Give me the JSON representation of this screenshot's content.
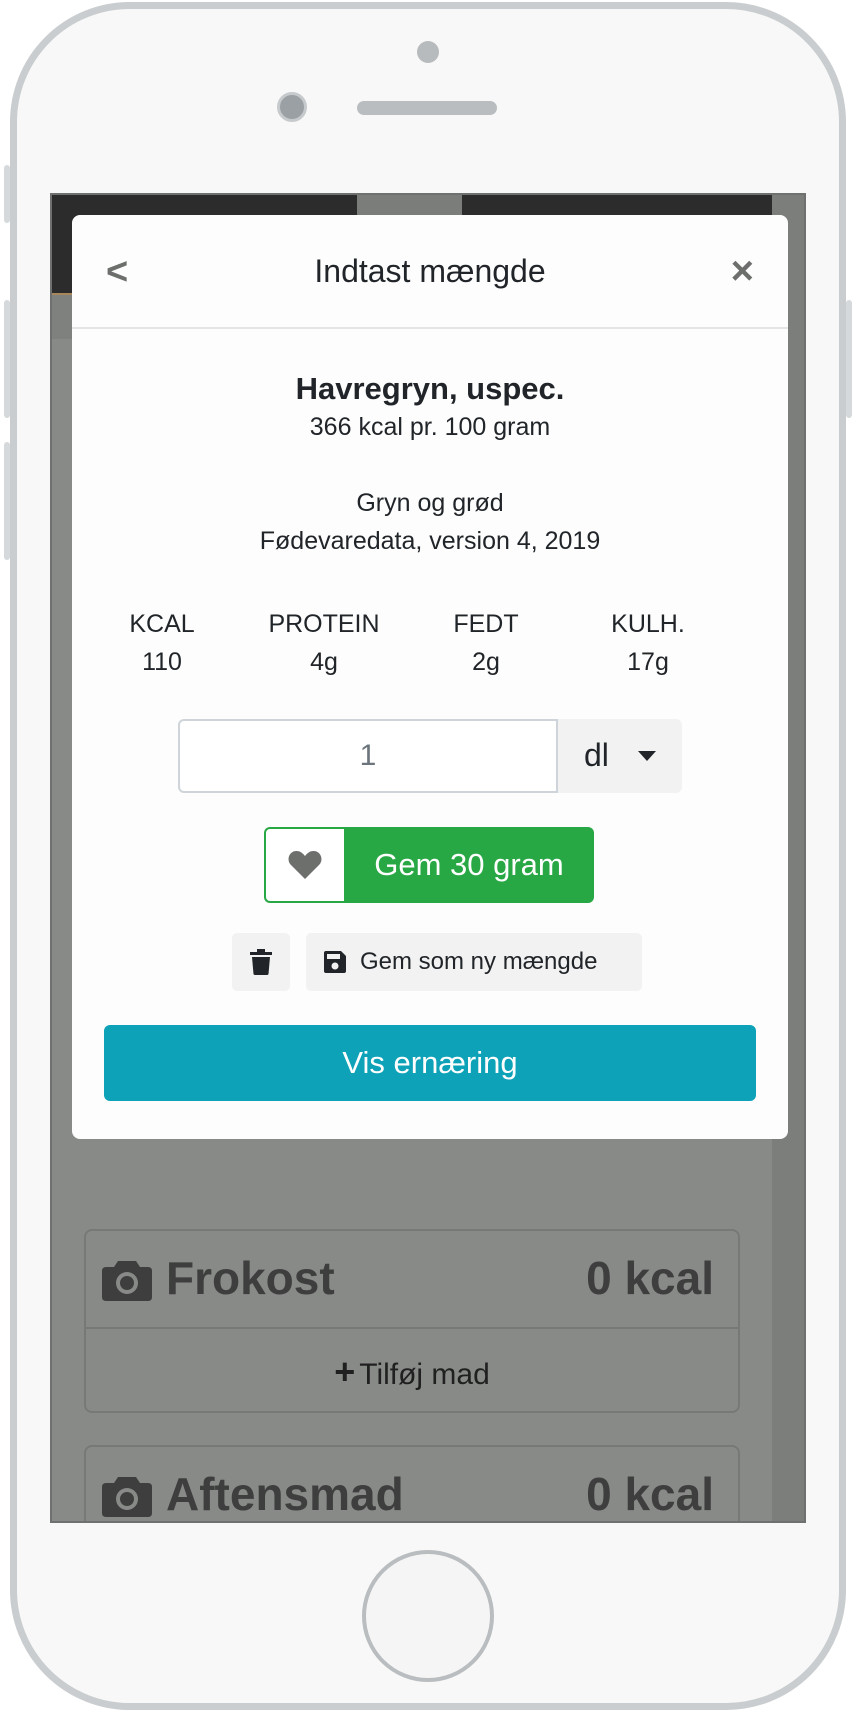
{
  "modal": {
    "back_label": "<",
    "title": "Indtast mængde",
    "close_label": "×",
    "food_name": "Havregryn, uspec.",
    "food_kcal": "366 kcal pr. 100 gram",
    "food_category": "Gryn og grød",
    "food_source": "Fødevaredata, version 4, 2019",
    "macros": [
      {
        "label": "KCAL",
        "value": "110"
      },
      {
        "label": "PROTEIN",
        "value": "4g"
      },
      {
        "label": "FEDT",
        "value": "2g"
      },
      {
        "label": "KULH.",
        "value": "17g"
      }
    ],
    "amount_value": "1",
    "unit_value": "dl",
    "save_label": "Gem 30 gram",
    "save_new_label": "Gem som ny mængde",
    "nutrition_label": "Vis ernæring"
  },
  "background": {
    "add_food_label": "Tilføj mad",
    "add_food_icon": "plus-icon",
    "meals": [
      {
        "title": "Frokost",
        "kcal": "0 kcal",
        "icon": "camera-icon"
      },
      {
        "title": "Aftensmad",
        "kcal": "0 kcal",
        "icon": "camera-icon"
      }
    ]
  },
  "colors": {
    "save_green": "#28a745",
    "info_teal": "#0ea2b8",
    "overlay_gray": "#888a88"
  }
}
